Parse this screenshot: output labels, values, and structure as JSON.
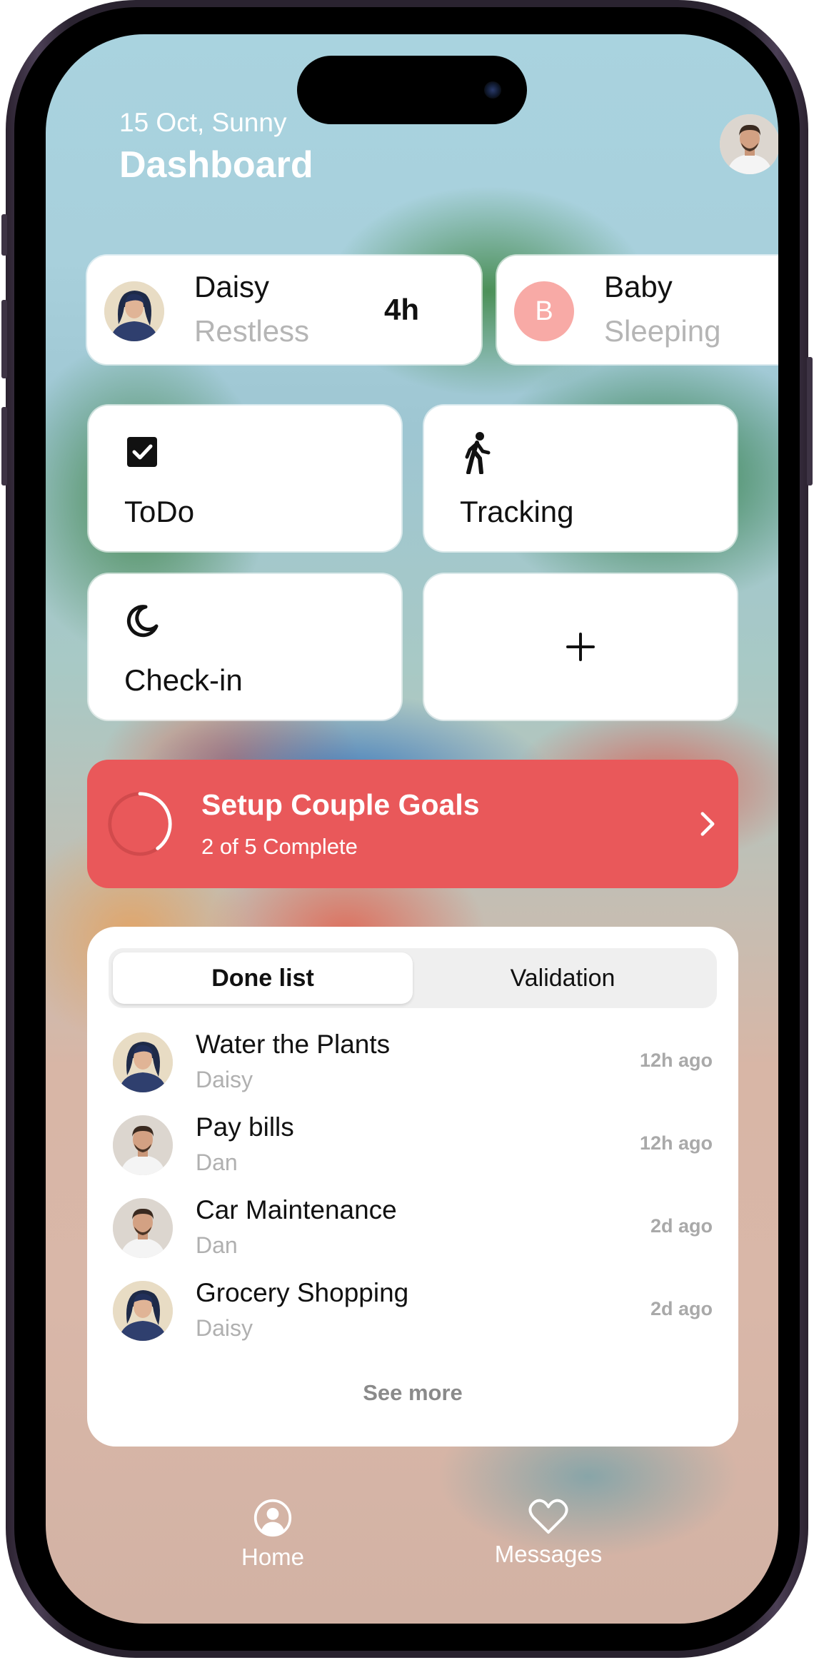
{
  "header": {
    "date": "15 Oct, Sunny",
    "title": "Dashboard"
  },
  "statuses": [
    {
      "name": "Daisy",
      "state": "Restless",
      "duration": "4h"
    },
    {
      "name": "Baby",
      "initial": "B",
      "state": "Sleeping"
    }
  ],
  "tiles": [
    {
      "label": "ToDo",
      "icon": "checkbox-icon"
    },
    {
      "label": "Tracking",
      "icon": "walking-icon"
    },
    {
      "label": "Check-in",
      "icon": "moon-icon"
    },
    {
      "label": "",
      "icon": "plus-icon"
    }
  ],
  "goals": {
    "title": "Setup Couple Goals",
    "subtitle": "2 of 5 Complete",
    "completed": 2,
    "total": 5
  },
  "tabs": {
    "active": "Done list",
    "inactive": "Validation"
  },
  "done_list": [
    {
      "task": "Water the Plants",
      "person": "Daisy",
      "time": "12h ago"
    },
    {
      "task": "Pay bills",
      "person": "Dan",
      "time": "12h ago"
    },
    {
      "task": "Car Maintenance",
      "person": "Dan",
      "time": "2d ago"
    },
    {
      "task": "Grocery Shopping",
      "person": "Daisy",
      "time": "2d ago"
    }
  ],
  "see_more": "See more",
  "nav": {
    "home": "Home",
    "messages": "Messages"
  },
  "colors": {
    "accent": "#e9585a",
    "baby_avatar": "#f8aaa6"
  }
}
